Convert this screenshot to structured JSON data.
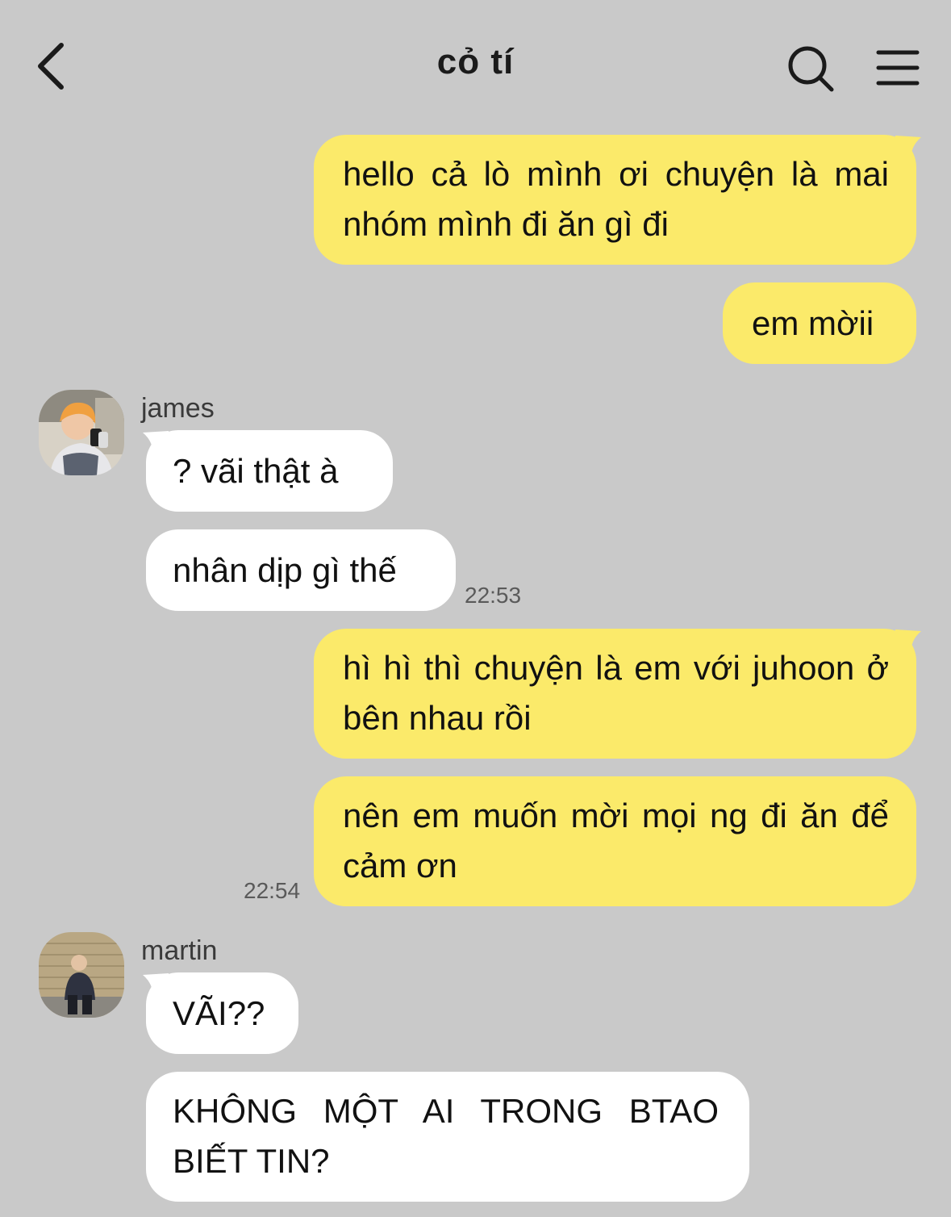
{
  "colors": {
    "background": "#c9c9c9",
    "my_bubble": "#fbea6a",
    "their_bubble": "#ffffff"
  },
  "header": {
    "title": "cỏ tí",
    "back_icon": "chevron-left-icon",
    "search_icon": "search-icon",
    "menu_icon": "hamburger-menu-icon"
  },
  "messages": [
    {
      "sender": "me",
      "text": "hello cả lò mình ơi chuyện là mai nhóm mình đi ăn gì đi"
    },
    {
      "sender": "me",
      "text": "em mời­i"
    },
    {
      "sender": "james",
      "text": "? vãi thật à"
    },
    {
      "sender": "james",
      "text": "nhân dịp gì thế",
      "time": "22:53"
    },
    {
      "sender": "me",
      "text": "hì hì thì chuyện là em với juhoon ở bên nhau rồi"
    },
    {
      "sender": "me",
      "text": "nên em muốn mời mọi ng đi ăn để cảm ơn",
      "time": "22:54"
    },
    {
      "sender": "martin",
      "text": "VÃI??"
    },
    {
      "sender": "martin",
      "text": "KHÔNG MỘT AI TRONG BTAO BIẾT TIN?"
    }
  ],
  "senders": {
    "james": "james",
    "martin": "martin"
  }
}
